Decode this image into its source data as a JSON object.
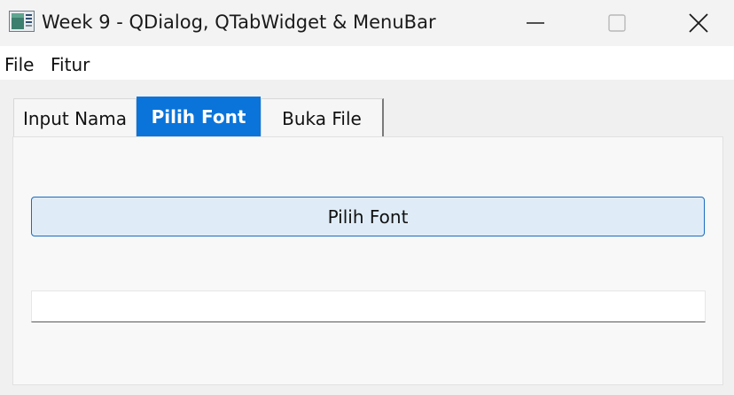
{
  "window": {
    "title": "Week 9 - QDialog, QTabWidget & MenuBar",
    "app_icon": "qt-app-icon",
    "controls": {
      "minimize_icon": "minimize-icon",
      "maximize_icon": "maximize-icon",
      "close_icon": "close-icon"
    }
  },
  "menubar": {
    "items": [
      {
        "label": "File"
      },
      {
        "label": "Fitur"
      }
    ]
  },
  "tabs": {
    "items": [
      {
        "label": "Input Nama",
        "active": false
      },
      {
        "label": "Pilih Font",
        "active": true
      },
      {
        "label": "Buka File",
        "active": false
      }
    ],
    "active_color": "#0a74da"
  },
  "content": {
    "button_label": "Pilih Font",
    "field_value": ""
  },
  "colors": {
    "accent": "#0a74da",
    "button_bg": "#dfecf8",
    "button_border": "#1a6cc0"
  }
}
